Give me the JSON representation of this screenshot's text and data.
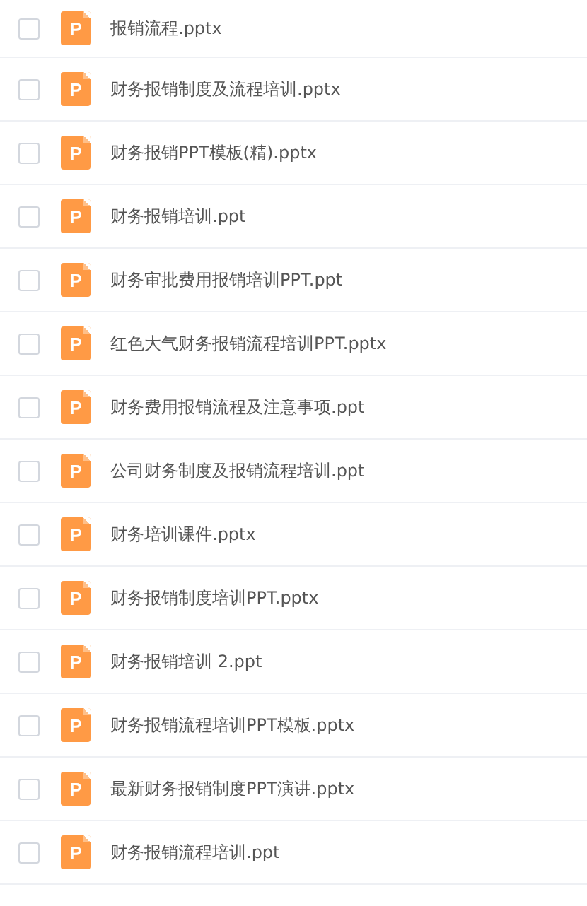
{
  "files": [
    {
      "name": "报销流程.pptx",
      "icon_letter": "P",
      "checked": false
    },
    {
      "name": "财务报销制度及流程培训.pptx",
      "icon_letter": "P",
      "checked": false
    },
    {
      "name": "财务报销PPT模板(精).pptx",
      "icon_letter": "P",
      "checked": false
    },
    {
      "name": "财务报销培训.ppt",
      "icon_letter": "P",
      "checked": false
    },
    {
      "name": "财务审批费用报销培训PPT.ppt",
      "icon_letter": "P",
      "checked": false
    },
    {
      "name": "红色大气财务报销流程培训PPT.pptx",
      "icon_letter": "P",
      "checked": false
    },
    {
      "name": "财务费用报销流程及注意事项.ppt",
      "icon_letter": "P",
      "checked": false
    },
    {
      "name": "公司财务制度及报销流程培训.ppt",
      "icon_letter": "P",
      "checked": false
    },
    {
      "name": "财务培训课件.pptx",
      "icon_letter": "P",
      "checked": false
    },
    {
      "name": "财务报销制度培训PPT.pptx",
      "icon_letter": "P",
      "checked": false
    },
    {
      "name": "财务报销培训 2.ppt",
      "icon_letter": "P",
      "checked": false
    },
    {
      "name": "财务报销流程培训PPT模板.pptx",
      "icon_letter": "P",
      "checked": false
    },
    {
      "name": "最新财务报销制度PPT演讲.pptx",
      "icon_letter": "P",
      "checked": false
    },
    {
      "name": "财务报销流程培训.ppt",
      "icon_letter": "P",
      "checked": false
    }
  ]
}
